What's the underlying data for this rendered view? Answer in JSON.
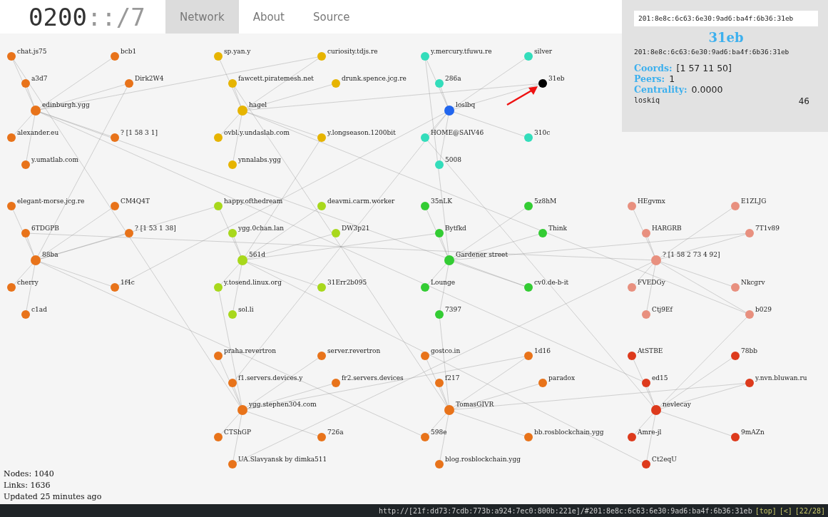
{
  "logo": {
    "prefix": "0200",
    "suffix": "::/7"
  },
  "nav": [
    {
      "label": "Network",
      "selected": true
    },
    {
      "label": "About",
      "selected": false
    },
    {
      "label": "Source",
      "selected": false
    }
  ],
  "search": {
    "value": "201:8e8c:6c63:6e30:9ad6:ba4f:6b36:31eb"
  },
  "info": {
    "title": "31eb",
    "address": "201:8e8c:6c63:6e30:9ad6:ba4f:6b36:31eb",
    "fields": [
      {
        "label": "Coords:",
        "value": "[1 57 11 50]"
      },
      {
        "label": "Peers:",
        "value": "1"
      },
      {
        "label": "Centrality:",
        "value": "0.0000"
      }
    ],
    "peers": [
      {
        "name": "loskiq",
        "value": "46"
      }
    ]
  },
  "clusters": [
    {
      "hub": {
        "label": "edinburgh.ygg",
        "color": "#e8731a"
      },
      "color": "#e8731a",
      "nodes": [
        {
          "label": "chat.js75",
          "selected": false
        },
        {
          "label": "bcb1",
          "selected": false
        },
        {
          "label": "a3d7",
          "selected": false
        },
        {
          "label": "Dirk2W4",
          "selected": false
        },
        {
          "label": "alexander.eu",
          "selected": false
        },
        {
          "label": "? [1 58 3 1]",
          "selected": false
        },
        {
          "label": "y.umatlab.com",
          "selected": false
        }
      ]
    },
    {
      "hub": {
        "label": "hagel",
        "color": "#e6b400"
      },
      "color": "#e6b400",
      "nodes": [
        {
          "label": "sp.yan.y",
          "selected": false
        },
        {
          "label": "curiosity.tdjs.re",
          "selected": false
        },
        {
          "label": "fawcett.piratemesh.net",
          "selected": false
        },
        {
          "label": "drunk.spence.jcg.re",
          "selected": false
        },
        {
          "label": "ovbl.y.undaslab.com",
          "selected": false
        },
        {
          "label": "y.longseason.1200bit",
          "selected": false
        },
        {
          "label": "ynnalabs.ygg",
          "selected": false
        }
      ]
    },
    {
      "hub": {
        "label": "loslbq",
        "color": "#2266ee"
      },
      "color": "#33ddbb",
      "nodes": [
        {
          "label": "y.mercury.tfuwu.re",
          "selected": false
        },
        {
          "label": "silver",
          "selected": false
        },
        {
          "label": "286a",
          "selected": false
        },
        {
          "label": "31eb",
          "selected": true
        },
        {
          "label": "HOME@SAIV46",
          "selected": false
        },
        {
          "label": "310c",
          "selected": false
        },
        {
          "label": "5008",
          "selected": false
        }
      ]
    },
    {
      "hub": {
        "label": "88ba",
        "color": "#e8731a"
      },
      "color": "#e8731a",
      "nodes": [
        {
          "label": "elegant-morse.jcg.re",
          "selected": false
        },
        {
          "label": "CM4Q4T",
          "selected": false
        },
        {
          "label": "6TDGPB",
          "selected": false
        },
        {
          "label": "? [1 53 1 38]",
          "selected": false
        },
        {
          "label": "cherry",
          "selected": false
        },
        {
          "label": "1f4c",
          "selected": false
        },
        {
          "label": "c1ad",
          "selected": false
        }
      ]
    },
    {
      "hub": {
        "label": "561d",
        "color": "#a8d81c"
      },
      "color": "#a8d81c",
      "nodes": [
        {
          "label": "happy.ofthedream",
          "selected": false
        },
        {
          "label": "deavmi.carm.worker",
          "selected": false
        },
        {
          "label": "ygg.0chan.lan",
          "selected": false
        },
        {
          "label": "DW3p21",
          "selected": false
        },
        {
          "label": "y.tosend.linux.org",
          "selected": false
        },
        {
          "label": "31Err2b095",
          "selected": false
        },
        {
          "label": "sol.li",
          "selected": false
        }
      ]
    },
    {
      "hub": {
        "label": "Gardener street",
        "color": "#33cc33"
      },
      "color": "#33cc33",
      "nodes": [
        {
          "label": "35nLK",
          "selected": false
        },
        {
          "label": "5z8hM",
          "selected": false
        },
        {
          "label": "Bytfkd",
          "selected": false
        },
        {
          "label": "Think",
          "selected": false
        },
        {
          "label": "Lounge",
          "selected": false
        },
        {
          "label": "cv0.de-b-it",
          "selected": false
        },
        {
          "label": "7397",
          "selected": false
        }
      ]
    },
    {
      "hub": {
        "label": "? [1 58 2 73 4 92]",
        "color": "#e8907f"
      },
      "color": "#e8907f",
      "nodes": [
        {
          "label": "HEgvmx",
          "selected": false
        },
        {
          "label": "E1ZLJG",
          "selected": false
        },
        {
          "label": "HARGRB",
          "selected": false
        },
        {
          "label": "7T1v89",
          "selected": false
        },
        {
          "label": "FVEDGy",
          "selected": false
        },
        {
          "label": "Nkcgrv",
          "selected": false
        },
        {
          "label": "Ctj9Ef",
          "selected": false
        },
        {
          "label": "b029",
          "selected": false
        }
      ]
    },
    {
      "hub": {
        "label": "ygg.stephen304.com",
        "color": "#e8731a"
      },
      "color": "#e8731a",
      "nodes": [
        {
          "label": "praha.revertron",
          "selected": false
        },
        {
          "label": "server.revertron",
          "selected": false
        },
        {
          "label": "f1.servers.devices.y",
          "selected": false
        },
        {
          "label": "fr2.servers.devices",
          "selected": false
        },
        {
          "label": "CTShGP",
          "selected": false
        },
        {
          "label": "726a",
          "selected": false
        },
        {
          "label": "UA.Slavyansk by dimka511",
          "selected": false
        }
      ]
    },
    {
      "hub": {
        "label": "TomasGIVR",
        "color": "#e8731a"
      },
      "color": "#e8731a",
      "nodes": [
        {
          "label": "gostco.in",
          "selected": false
        },
        {
          "label": "1d16",
          "selected": false
        },
        {
          "label": "f217",
          "selected": false
        },
        {
          "label": "paradox",
          "selected": false
        },
        {
          "label": "598e",
          "selected": false
        },
        {
          "label": "bb.rosblockchain.ygg",
          "selected": false
        },
        {
          "label": "blog.rosblockchain.ygg",
          "selected": false
        }
      ]
    },
    {
      "hub": {
        "label": "nevlecay",
        "color": "#dd3a1c"
      },
      "color": "#dd3a1c",
      "nodes": [
        {
          "label": "AtSTBE",
          "selected": false
        },
        {
          "label": "78bb",
          "selected": false
        },
        {
          "label": "ed15",
          "selected": false
        },
        {
          "label": "y.nvn.bluwan.ru",
          "selected": false
        },
        {
          "label": "Amre-jl",
          "selected": false
        },
        {
          "label": "9mAZn",
          "selected": false
        },
        {
          "label": "Ct2eqU",
          "selected": false
        }
      ]
    }
  ],
  "stats": [
    "Nodes: 1040",
    "Links: 1636",
    "Updated 25 minutes ago"
  ],
  "status": {
    "url": "http://[21f:dd73:7cdb:773b:a924:7ec0:800b:221e]/#201:8e8c:6c63:6e30:9ad6:ba4f:6b36:31eb",
    "links": [
      "[top]",
      "[<]",
      "[22/28]"
    ]
  }
}
